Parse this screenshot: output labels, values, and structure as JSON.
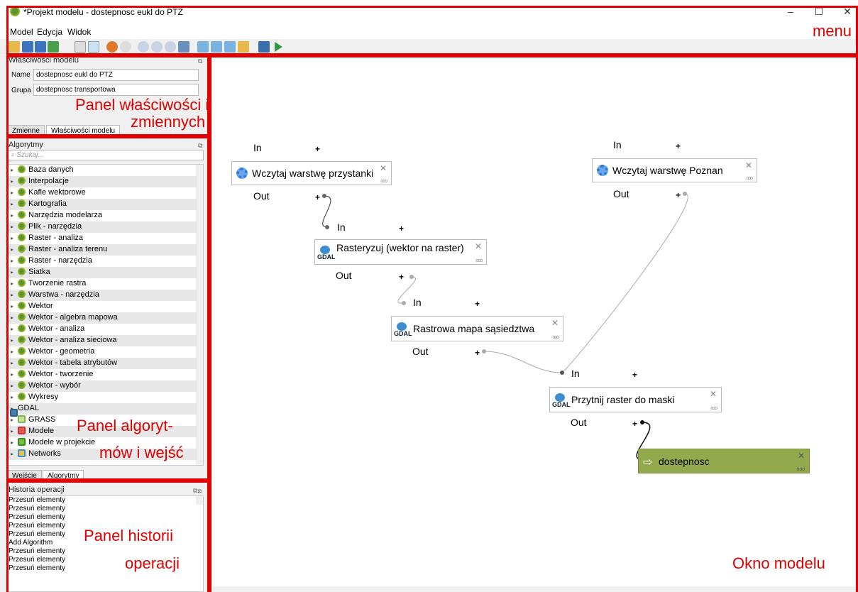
{
  "window": {
    "title": "*Projekt modelu - dostepnosc eukl do PTZ",
    "minimize": "–",
    "maximize": "☐",
    "close": "✕"
  },
  "menu": [
    "Model",
    "Edycja",
    "Widok"
  ],
  "properties_panel": {
    "title": "Właściwości modelu",
    "name_label": "Name",
    "name_value": "dostepnosc eukl do PTZ",
    "group_label": "Grupa",
    "group_value": "dostepnosc transportowa",
    "tabs": [
      "Zmienne",
      "Właściwości modelu"
    ]
  },
  "algorithms_panel": {
    "title": "Algorytmy",
    "search_placeholder": "Szukaj...",
    "items": [
      {
        "label": "Baza danych",
        "icon": "qgis-icon"
      },
      {
        "label": "Interpolacje",
        "icon": "qgis-icon"
      },
      {
        "label": "Kafle wektorowe",
        "icon": "qgis-icon"
      },
      {
        "label": "Kartografia",
        "icon": "qgis-icon"
      },
      {
        "label": "Narzędzia modelarza",
        "icon": "qgis-icon"
      },
      {
        "label": "Plik - narzędzia",
        "icon": "qgis-icon"
      },
      {
        "label": "Raster - analiza",
        "icon": "qgis-icon"
      },
      {
        "label": "Raster - analiza terenu",
        "icon": "qgis-icon"
      },
      {
        "label": "Raster - narzędzia",
        "icon": "qgis-icon"
      },
      {
        "label": "Siatka",
        "icon": "qgis-icon"
      },
      {
        "label": "Tworzenie rastra",
        "icon": "qgis-icon"
      },
      {
        "label": "Warstwa - narzędzia",
        "icon": "qgis-icon"
      },
      {
        "label": "Wektor",
        "icon": "qgis-icon"
      },
      {
        "label": "Wektor - algebra mapowa",
        "icon": "qgis-icon"
      },
      {
        "label": "Wektor - analiza",
        "icon": "qgis-icon"
      },
      {
        "label": "Wektor - analiza sieciowa",
        "icon": "qgis-icon"
      },
      {
        "label": "Wektor - geometria",
        "icon": "qgis-icon"
      },
      {
        "label": "Wektor - tabela atrybutów",
        "icon": "qgis-icon"
      },
      {
        "label": "Wektor - tworzenie",
        "icon": "qgis-icon"
      },
      {
        "label": "Wektor - wybór",
        "icon": "qgis-icon"
      },
      {
        "label": "Wykresy",
        "icon": "qgis-icon"
      },
      {
        "label": "GDAL",
        "icon": "gdal-icon"
      },
      {
        "label": "GRASS",
        "icon": "grass-icon"
      },
      {
        "label": "Modele",
        "icon": "models-icon"
      },
      {
        "label": "Modele w projekcie",
        "icon": "project-models-icon"
      },
      {
        "label": "Networks",
        "icon": "networks-icon"
      }
    ],
    "tabs": [
      "Wejście",
      "Algorytmy"
    ]
  },
  "history_panel": {
    "title": "Historia operacji",
    "items": [
      "Przesuń elementy",
      "Przesuń elementy",
      "Przesuń elementy",
      "Przesuń elementy",
      "Przesuń elementy",
      "Add Algorithm",
      "Przesuń elementy",
      "Przesuń elementy",
      "Przesuń elementy"
    ]
  },
  "model": {
    "in_label": "In",
    "out_label": "Out",
    "plus": "+",
    "nodes": {
      "przystanki": "Wczytaj warstwę przystanki",
      "poznan": "Wczytaj warstwę Poznan",
      "rasteryzuj": "Rasteryzuj (wektor na raster)",
      "sasiedztwo": "Rastrowa mapa sąsiedztwa",
      "przytnij": "Przytnij raster do maski",
      "output": "dostepnosc"
    },
    "gdal_text": "GDAL"
  },
  "annotations": {
    "menu": "menu",
    "properties_1": "Panel właściwości i",
    "properties_2": "zmiennych",
    "algorithms_1": "Panel algoryt-",
    "algorithms_2": "mów i wejść",
    "history_1": "Panel historii",
    "history_2": "operacji",
    "model_window": "Okno modelu"
  },
  "colors": {
    "annotation": "#e00000",
    "output_node": "#93a94e",
    "accent_green": "#589632"
  }
}
